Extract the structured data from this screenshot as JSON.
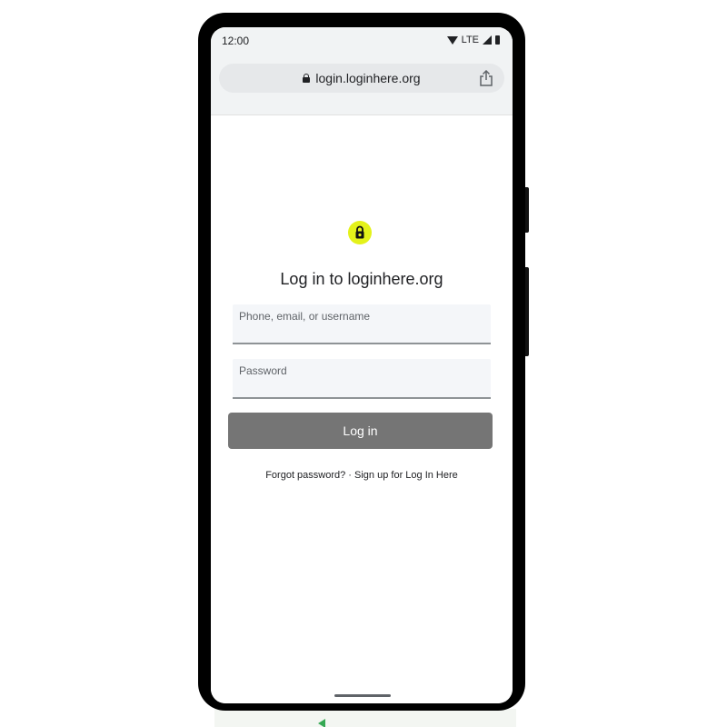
{
  "status_bar": {
    "time": "12:00",
    "network": "LTE",
    "icons": [
      "wifi-icon",
      "signal-icon",
      "battery-icon"
    ]
  },
  "browser": {
    "url": "login.loginhere.org",
    "secure_icon": "lock-icon",
    "share_icon": "share-icon"
  },
  "login": {
    "logo_icon": "lock-icon",
    "logo_color": "#e4f21a",
    "title": "Log in to loginhere.org",
    "username_placeholder": "Phone, email, or username",
    "password_placeholder": "Password",
    "button_label": "Log in",
    "button_color": "#757575",
    "forgot_password": "Forgot password?",
    "separator": " · ",
    "signup": "Sign up for Log In Here"
  }
}
